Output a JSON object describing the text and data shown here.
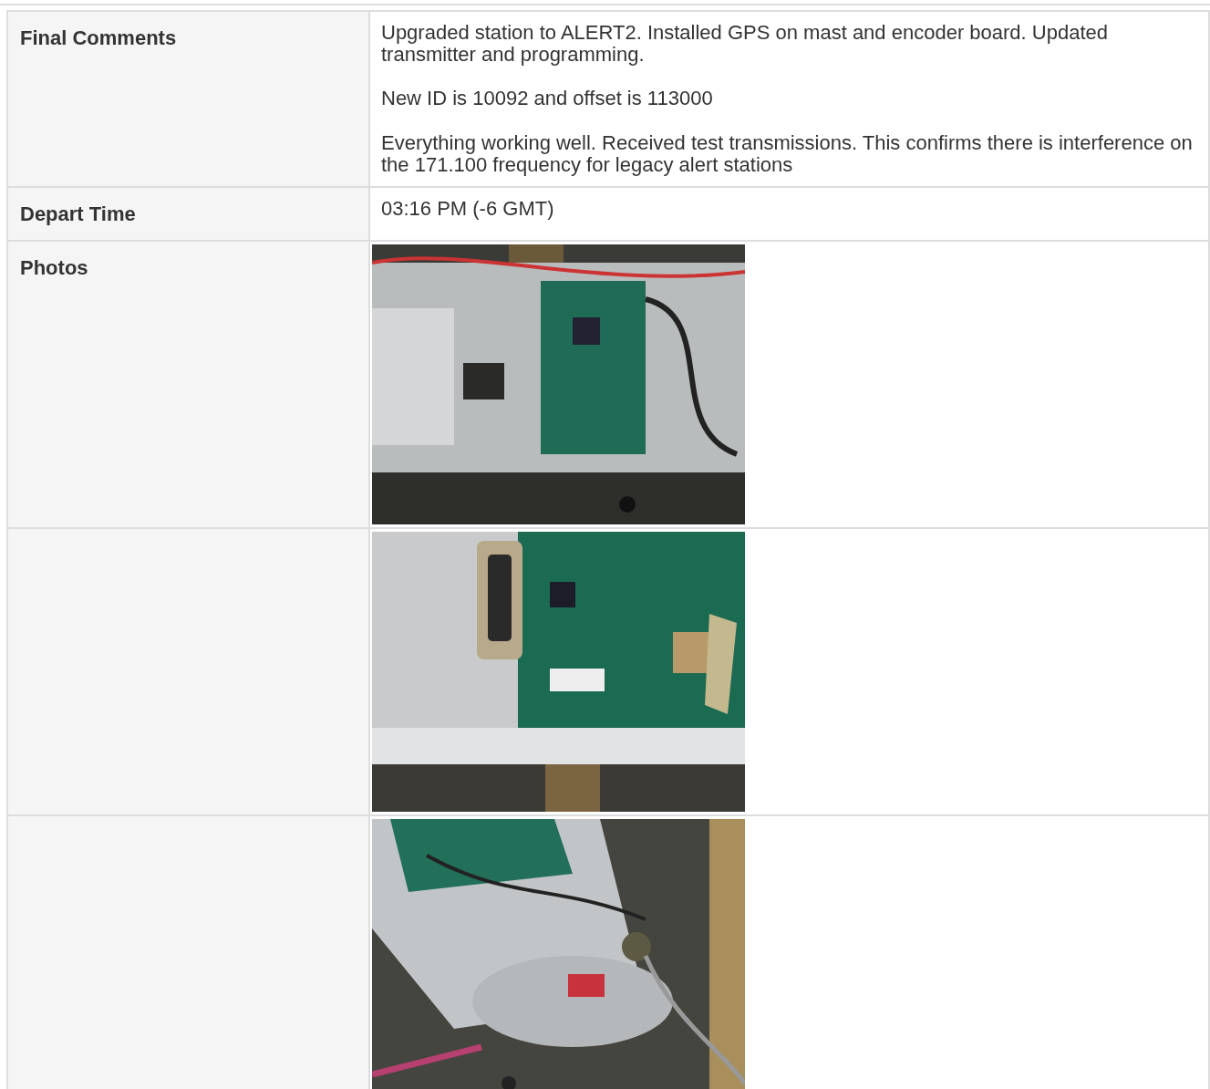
{
  "rows": [
    {
      "label": "Final Comments",
      "kind": "text",
      "paragraphs": [
        "Upgraded station to ALERT2. Installed GPS on mast and encoder board. Updated transmitter and programming.",
        "New ID is 10092 and offset is 113000",
        "Everything working well. Received test transmissions. This confirms there is interference on the 171.100 frequency for legacy alert stations"
      ]
    },
    {
      "label": "Depart Time",
      "kind": "text",
      "paragraphs": [
        "03:16 PM (-6 GMT)"
      ]
    },
    {
      "label": "Photos",
      "kind": "picture"
    },
    {
      "kind": "picture"
    },
    {
      "kind": "picture"
    }
  ]
}
